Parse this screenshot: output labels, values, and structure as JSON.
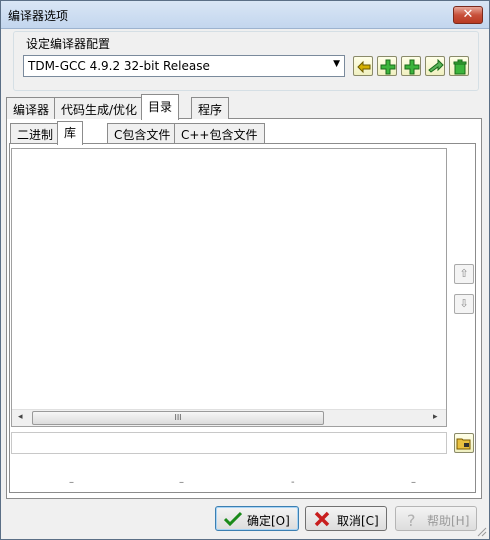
{
  "window": {
    "title": "编译器选项",
    "close_label": "✕"
  },
  "compiler_set": {
    "group_label": "设定编译器配置",
    "selected": "TDM-GCC 4.9.2 32-bit Release"
  },
  "toolbar_icons": [
    "find-compiler-icon",
    "add-icon",
    "add-copy-icon",
    "rename-icon",
    "delete-icon"
  ],
  "main_tabs": [
    {
      "label": "编译器"
    },
    {
      "label": "代码生成/优化"
    },
    {
      "label": "目录"
    },
    {
      "label": "程序"
    }
  ],
  "sub_tabs": [
    {
      "label": "二进制"
    },
    {
      "label": "库"
    },
    {
      "label": "C包含文件"
    },
    {
      "label": "C++包含文件"
    }
  ],
  "scrollbar": {
    "thumb_grip": "III",
    "left": "◂",
    "right": "▸"
  },
  "side_buttons": {
    "up": "⇧",
    "down": "⇩"
  },
  "path_input": {
    "value": ""
  },
  "dashes": [
    "–",
    "–",
    "-",
    "–"
  ],
  "buttons": {
    "ok": "确定[O]",
    "cancel": "取消[C]",
    "help": "帮助[H]"
  },
  "colors": {
    "ok_check": "#1a8a1a",
    "cancel_x": "#c81e1e",
    "help_disabled": "#b0b0b0"
  }
}
